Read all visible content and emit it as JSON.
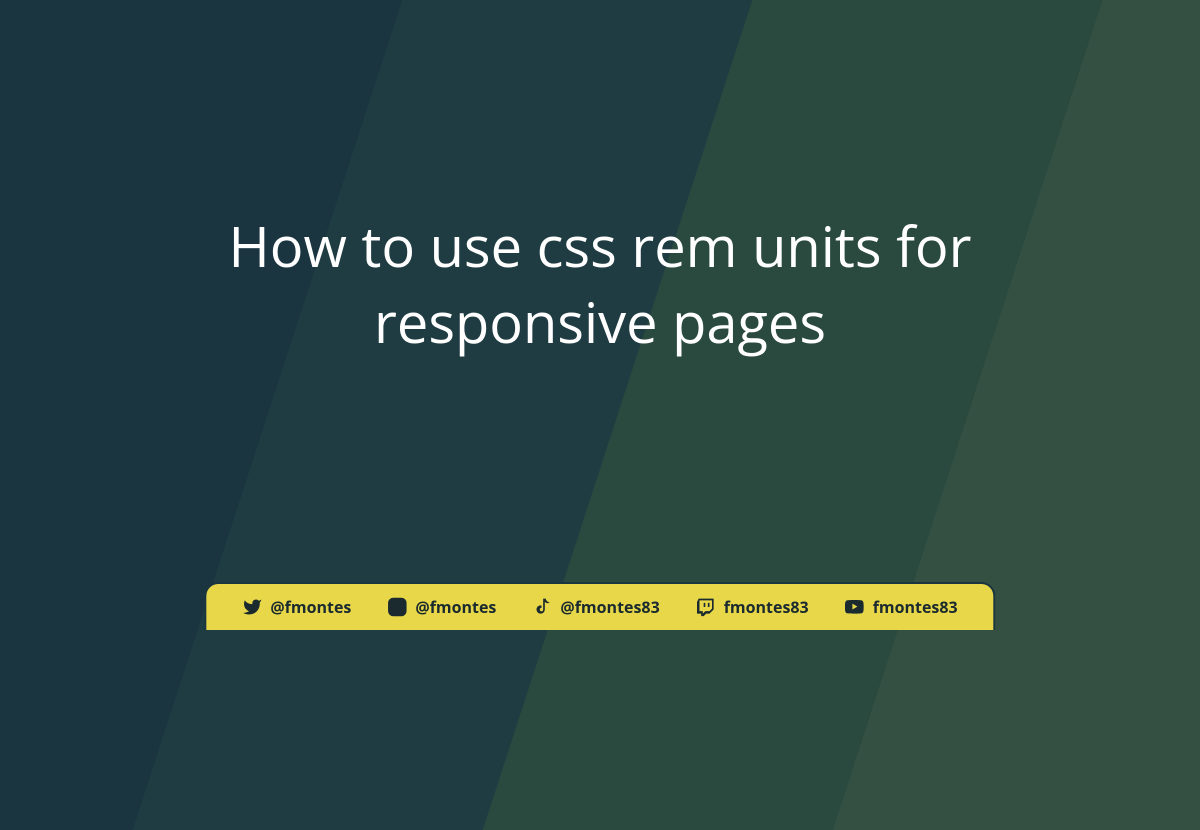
{
  "title": "How to use css rem units for responsive pages",
  "socials": [
    {
      "icon": "twitter",
      "handle": "@fmontes"
    },
    {
      "icon": "instagram",
      "handle": "@fmontes"
    },
    {
      "icon": "tiktok",
      "handle": "@fmontes83"
    },
    {
      "icon": "twitch",
      "handle": "fmontes83"
    },
    {
      "icon": "youtube",
      "handle": "fmontes83"
    }
  ],
  "colors": {
    "accent": "#e8d849",
    "bg_dark": "#1a3440",
    "text_light": "#ffffff",
    "text_dark": "#1a2a2e"
  }
}
